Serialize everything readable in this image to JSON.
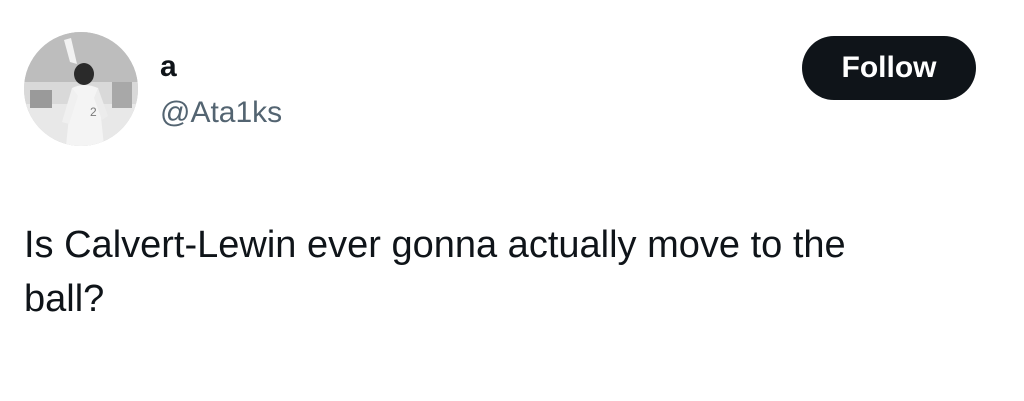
{
  "author": {
    "display_name": "a",
    "handle": "@Ata1ks",
    "avatar_icon": "profile-photo-icon"
  },
  "actions": {
    "follow_label": "Follow"
  },
  "post": {
    "text": "Is Calvert-Lewin ever gonna actually move to the\nball?"
  },
  "colors": {
    "text_primary": "#0f1419",
    "text_secondary": "#536471",
    "button_bg": "#0f1419",
    "button_text": "#ffffff",
    "background": "#ffffff"
  }
}
